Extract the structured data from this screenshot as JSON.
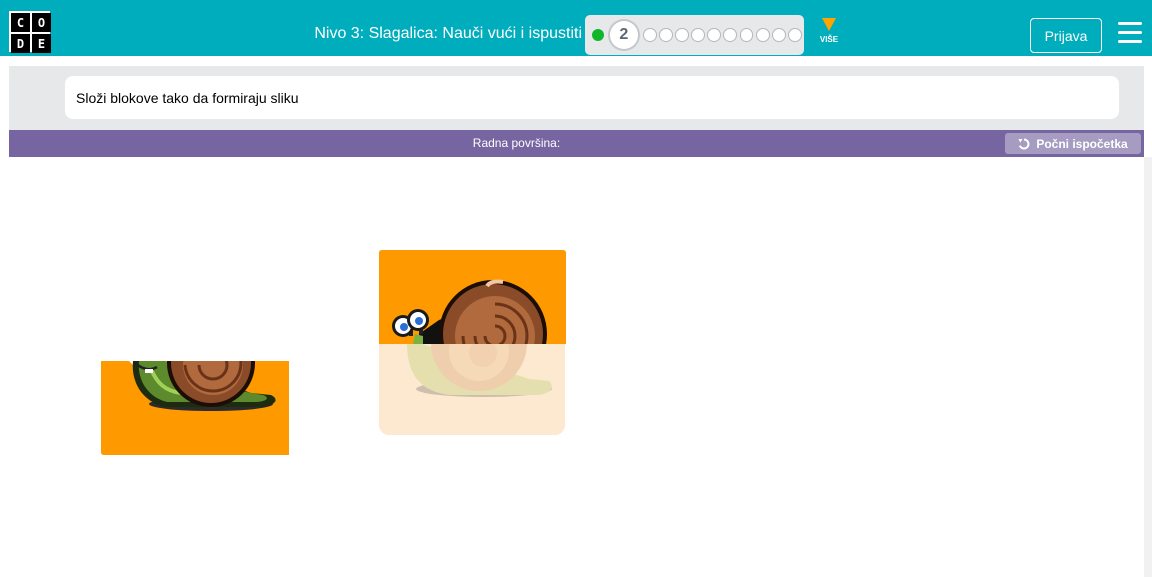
{
  "header": {
    "logo_letters": [
      "C",
      "O",
      "D",
      "E"
    ],
    "level_title": "Nivo 3: Slagalica: Nauči vući i ispustiti",
    "progress": {
      "completed_count": 1,
      "current_level": "2",
      "remaining_count": 10
    },
    "more_label": "VIŠE",
    "signin_label": "Prijava"
  },
  "instructions": {
    "text": "Složi blokove tako da formiraju sliku"
  },
  "workspace": {
    "title": "Radna površina:",
    "reset_label": "Počni ispočetka"
  },
  "colors": {
    "header_bg": "#00adbc",
    "workspace_header_bg": "#7665a0",
    "reset_button_bg": "#a69bc1",
    "piece_orange": "#ff9900",
    "slot_bg": "#fde9cf",
    "progress_done": "#0fb62c",
    "more_arrow": "#ffa400"
  },
  "icons": {
    "reset": "undo-icon",
    "menu": "hamburger-menu-icon",
    "more": "triangle-down-icon"
  }
}
